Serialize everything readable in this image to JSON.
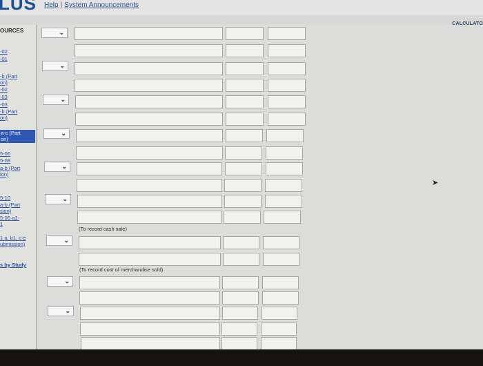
{
  "app": {
    "logo": "LUS",
    "help_link": "Help",
    "separator": "|",
    "announcements_link": "System Announcements",
    "calculator": "CALCULATO"
  },
  "sidebar": {
    "title": "OURCES",
    "links": [
      "-02",
      "-01",
      "-b (Part",
      "on)",
      "-02",
      "-03",
      "-03",
      "-b (Part",
      "on)",
      "5-06",
      "5-08",
      "a-b (Part",
      "ion)",
      "5-10",
      "a-b (Part",
      "sion)",
      "5-05 a1-",
      "1",
      "1 a, b1, c-e",
      "ubmission)"
    ],
    "active_item": [
      "a-c (Part",
      "on)"
    ],
    "study_link": "s by Study"
  },
  "journal": {
    "note_cash_sale": "(To record cash sale)",
    "note_cost_sold": "(To record cost of merchandise sold)"
  },
  "icons": {
    "dropdown": "chevron-down-icon",
    "cursor": "mouse-pointer-icon"
  }
}
